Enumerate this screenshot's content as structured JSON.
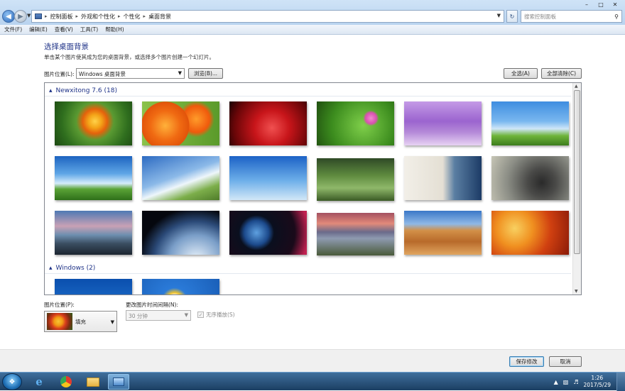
{
  "address": {
    "crumbs": [
      "控制面板",
      "外观和个性化",
      "个性化",
      "桌面背景"
    ],
    "search_placeholder": "搜索控制面板"
  },
  "menu": [
    "文件(F)",
    "编辑(E)",
    "查看(V)",
    "工具(T)",
    "帮助(H)"
  ],
  "page": {
    "title": "选择桌面背景",
    "subtitle": "单击某个图片使其成为您的桌面背景，或选择多个图片创建一个幻灯片。"
  },
  "location": {
    "label": "图片位置(L):",
    "value": "Windows 桌面背景",
    "browse": "浏览(B)...",
    "select_all": "全选(A)",
    "clear_all": "全部清除(C)"
  },
  "groups": [
    {
      "label": "Newxitong 7.6 (18)"
    },
    {
      "label": "Windows (2)"
    }
  ],
  "thumb_icons": [
    "orange-flower",
    "orange-flowers",
    "red-petal-droplets",
    "pink-cosmos",
    "lavender-field",
    "daisy-sky",
    "grass-cloud-sky",
    "wind-turbine",
    "eiffel-tower",
    "bicycle-garden",
    "girl-portrait",
    "turntable",
    "sea-sunset",
    "earth-orbit",
    "planet-space",
    "volcano-landscape",
    "desert-pyramids",
    "autumn-trees",
    "windows-blue",
    "white-daisy"
  ],
  "position": {
    "label": "图片位置(P):",
    "value": "填充"
  },
  "interval": {
    "label": "更改图片时间间隔(N):",
    "value": "30 分钟"
  },
  "shuffle": {
    "label": "无序播放(S)",
    "checked": true
  },
  "footer": {
    "save": "保存修改",
    "cancel": "取消"
  },
  "clock": {
    "time": "1:26",
    "date": "2017/5/29"
  }
}
